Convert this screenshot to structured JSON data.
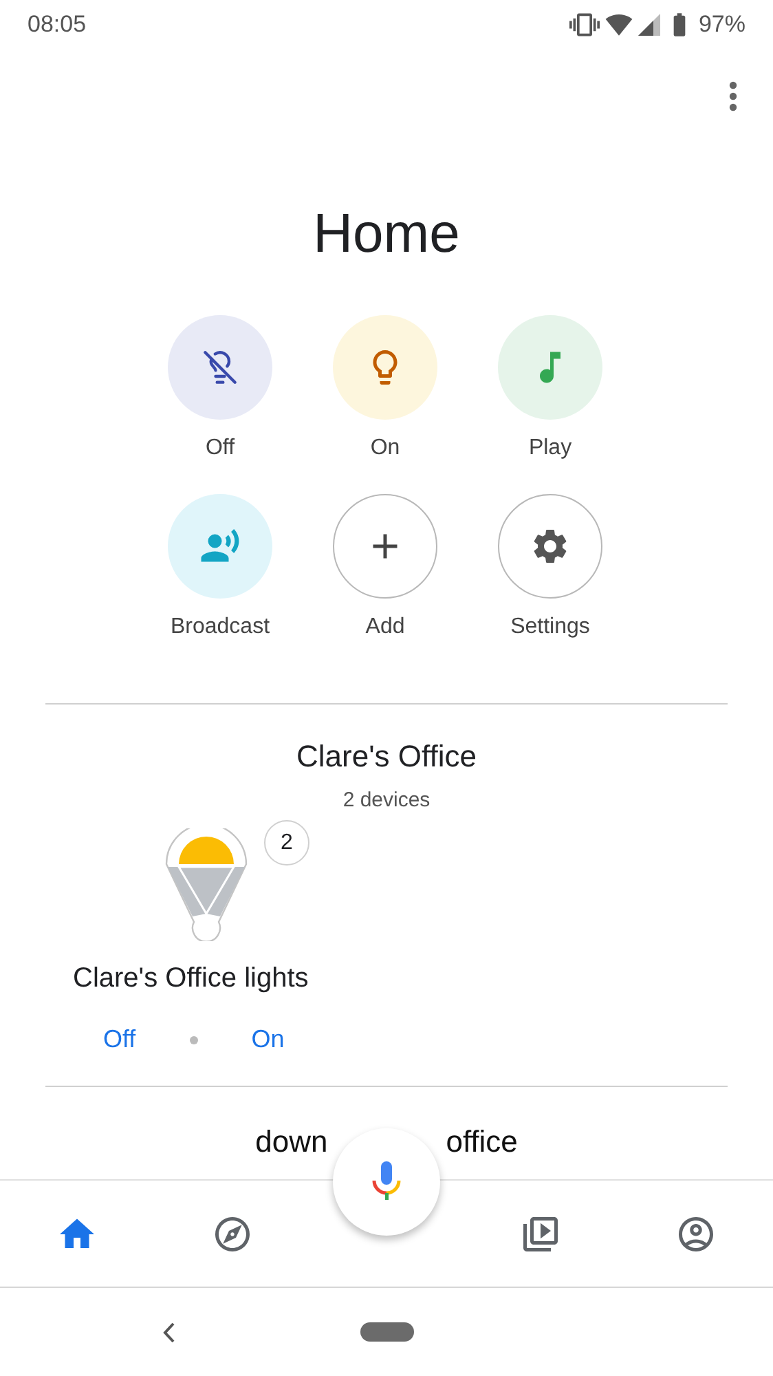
{
  "status_bar": {
    "time": "08:05",
    "battery": "97%"
  },
  "title": "Home",
  "quick_actions": [
    {
      "label": "Off",
      "kind": "lights_off"
    },
    {
      "label": "On",
      "kind": "lights_on"
    },
    {
      "label": "Play",
      "kind": "play"
    },
    {
      "label": "Broadcast",
      "kind": "broadcast"
    },
    {
      "label": "Add",
      "kind": "add"
    },
    {
      "label": "Settings",
      "kind": "settings"
    }
  ],
  "rooms": [
    {
      "name": "Clare's Office",
      "count": "2 devices",
      "devices": [
        {
          "name": "Clare's Office lights",
          "badge": "2",
          "actions": [
            "Off",
            "On"
          ]
        }
      ]
    }
  ],
  "next_room": {
    "name_parts": [
      "down",
      "office"
    ]
  },
  "bottom_nav": [
    {
      "kind": "home",
      "selected": true
    },
    {
      "kind": "discover",
      "selected": false
    },
    {
      "kind": "media",
      "selected": false
    },
    {
      "kind": "account",
      "selected": false
    }
  ]
}
